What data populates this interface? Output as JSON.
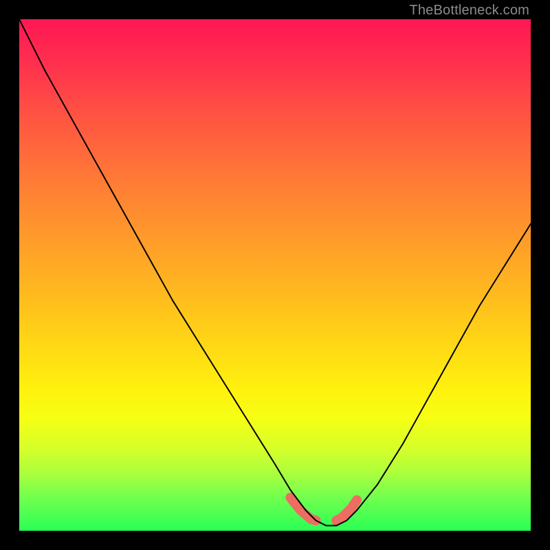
{
  "watermark": "TheBottleneck.com",
  "chart_data": {
    "type": "line",
    "title": "",
    "xlabel": "",
    "ylabel": "",
    "xlim": [
      0,
      100
    ],
    "ylim": [
      0,
      100
    ],
    "grid": false,
    "legend": false,
    "background_gradient": {
      "orientation": "vertical",
      "stops": [
        {
          "pos": 0.0,
          "color": "#ff1754"
        },
        {
          "pos": 0.2,
          "color": "#ff5741"
        },
        {
          "pos": 0.44,
          "color": "#ff9e29"
        },
        {
          "pos": 0.64,
          "color": "#ffd915"
        },
        {
          "pos": 0.78,
          "color": "#f6ff14"
        },
        {
          "pos": 0.89,
          "color": "#a8ff3e"
        },
        {
          "pos": 1.0,
          "color": "#29ff55"
        }
      ]
    },
    "series": [
      {
        "name": "curve",
        "color": "#000000",
        "stroke_width": 2,
        "x": [
          0,
          5,
          10,
          15,
          20,
          25,
          30,
          35,
          40,
          45,
          50,
          53,
          56,
          58,
          60,
          62,
          64,
          66,
          70,
          75,
          80,
          85,
          90,
          95,
          100
        ],
        "y": [
          100,
          90,
          81,
          72,
          63,
          54,
          45,
          37,
          29,
          21,
          13,
          8,
          4,
          2,
          1,
          1,
          2,
          4,
          9,
          17,
          26,
          35,
          44,
          52,
          60
        ]
      }
    ],
    "markers": [
      {
        "name": "bottom-accent-left",
        "color": "#ec6d62",
        "shape": "rounded-segment",
        "approx_points": [
          {
            "x": 53,
            "y": 6.5
          },
          {
            "x": 55,
            "y": 4.0
          },
          {
            "x": 57,
            "y": 2.3
          },
          {
            "x": 58,
            "y": 2.0
          }
        ],
        "thickness": 14
      },
      {
        "name": "bottom-accent-right",
        "color": "#ec6d62",
        "shape": "rounded-segment",
        "approx_points": [
          {
            "x": 62,
            "y": 2.0
          },
          {
            "x": 63,
            "y": 2.5
          },
          {
            "x": 65,
            "y": 4.5
          },
          {
            "x": 66,
            "y": 6.0
          }
        ],
        "thickness": 14
      }
    ]
  }
}
